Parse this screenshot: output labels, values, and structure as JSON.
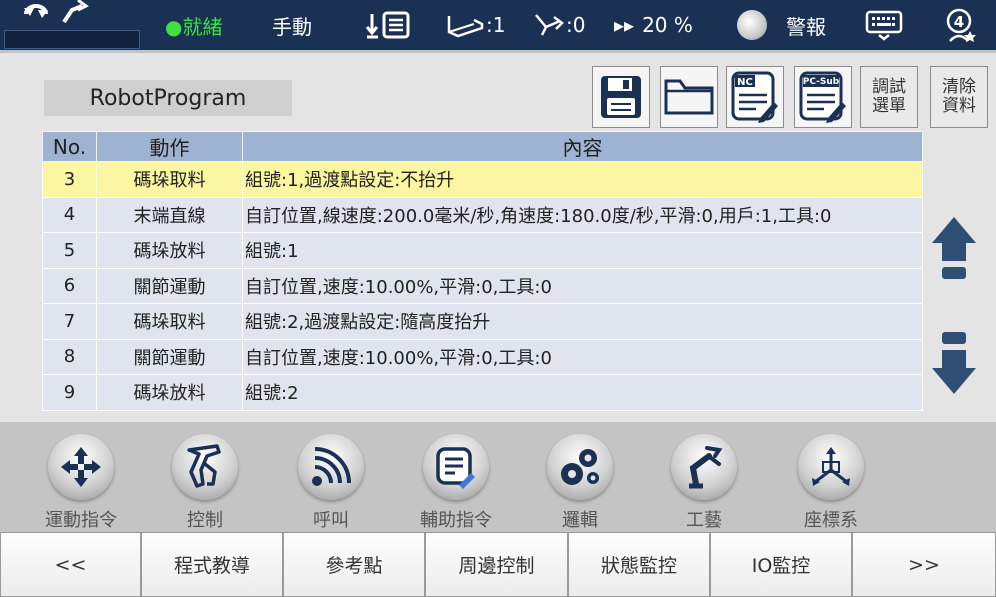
{
  "status_bar": {
    "ready": "●就緒",
    "mode": "手動",
    "base_value": ":1",
    "tool_value": ":0",
    "speed_prefix": "▸▸",
    "speed_value": "20 %",
    "alarm": "警報"
  },
  "program": {
    "title": "RobotProgram",
    "toolbar": {
      "nc": "NC",
      "pcsub": "PC-Sub",
      "debug_line1": "調試",
      "debug_line2": "選單",
      "clear_line1": "清除",
      "clear_line2": "資料"
    },
    "columns": {
      "no": "No.",
      "action": "動作",
      "content": "內容"
    },
    "rows": [
      {
        "no": "3",
        "action": "碼垛取料",
        "content": "組號:1,過渡點設定:不抬升"
      },
      {
        "no": "4",
        "action": "末端直線",
        "content": "自訂位置,線速度:200.0毫米/秒,角速度:180.0度/秒,平滑:0,用戶:1,工具:0"
      },
      {
        "no": "5",
        "action": "碼垛放料",
        "content": "組號:1"
      },
      {
        "no": "6",
        "action": "關節運動",
        "content": "自訂位置,速度:10.00%,平滑:0,工具:0"
      },
      {
        "no": "7",
        "action": "碼垛取料",
        "content": "組號:2,過渡點設定:隨高度抬升"
      },
      {
        "no": "8",
        "action": "關節運動",
        "content": "自訂位置,速度:10.00%,平滑:0,工具:0"
      },
      {
        "no": "9",
        "action": "碼垛放料",
        "content": "組號:2"
      }
    ]
  },
  "functions": {
    "motion": "運動指令",
    "control": "控制",
    "call": "呼叫",
    "aux": "輔助指令",
    "logic": "邏輯",
    "process": "工藝",
    "coord": "座標系"
  },
  "nav": {
    "prev": "<<",
    "teach": "程式教導",
    "ref_point": "參考點",
    "periphery": "周邊控制",
    "status_monitor": "狀態監控",
    "io_monitor": "IO監控",
    "next": ">>"
  },
  "colors": {
    "topbar": "#1a3153",
    "ready_green": "#3fe03f",
    "header_blue": "#9eb3d1",
    "selected_row": "#fbf6a1",
    "arrow_blue": "#2f4e74"
  }
}
